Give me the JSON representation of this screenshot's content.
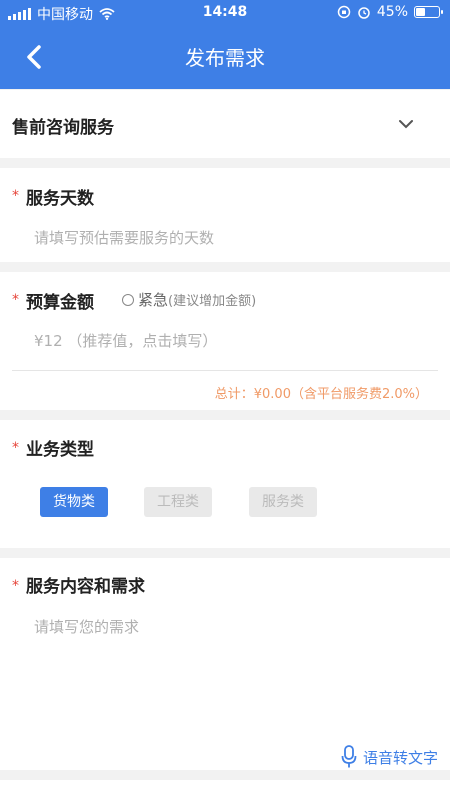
{
  "status_bar": {
    "carrier": "中国移动",
    "time": "14:48",
    "battery": "45%",
    "battery_level": 0.45
  },
  "nav": {
    "title": "发布需求"
  },
  "category": {
    "selected": "售前咨询服务"
  },
  "service_days": {
    "label": "服务天数",
    "placeholder": "请填写预估需要服务的天数"
  },
  "budget": {
    "label": "预算金额",
    "urgent_label": "紧急",
    "urgent_hint": "(建议增加金额)",
    "placeholder": "¥12 （推荐值，点击填写）",
    "total": "总计：¥0.00（含平台服务费2.0%）"
  },
  "business_type": {
    "label": "业务类型",
    "options": [
      {
        "label": "货物类",
        "active": true
      },
      {
        "label": "工程类",
        "active": false
      },
      {
        "label": "服务类",
        "active": false
      }
    ]
  },
  "content": {
    "label": "服务内容和需求",
    "placeholder": "请填写您的需求",
    "voice_label": "语音转文字"
  },
  "colors": {
    "primary": "#3e7fe6",
    "required": "#e6453a",
    "total_text": "#f09a67"
  },
  "required_mark": "*"
}
